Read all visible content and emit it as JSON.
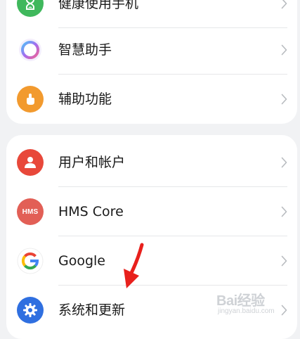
{
  "settings": {
    "group1": [
      {
        "label": "健康使用手机",
        "icon": "hourglass-icon",
        "color": "#3fb85c"
      },
      {
        "label": "智慧助手",
        "icon": "assistant-ring-icon",
        "color": "#a36bf0"
      },
      {
        "label": "辅助功能",
        "icon": "hand-pointer-icon",
        "color": "#f29a2e"
      }
    ],
    "group2": [
      {
        "label": "用户和帐户",
        "icon": "user-icon",
        "color": "#e8483a"
      },
      {
        "label": "HMS Core",
        "icon": "hms-icon",
        "icon_text": "HMS",
        "color": "#e25f56"
      },
      {
        "label": "Google",
        "icon": "google-icon",
        "color": "#4285f4"
      },
      {
        "label": "系统和更新",
        "icon": "gear-icon",
        "color": "#2f6fe0"
      }
    ]
  },
  "annotation": {
    "icon": "red-arrow-icon",
    "color": "#e8201c"
  },
  "watermark": {
    "brand": "Bai经验",
    "url": "jingyan.baidu.com"
  }
}
